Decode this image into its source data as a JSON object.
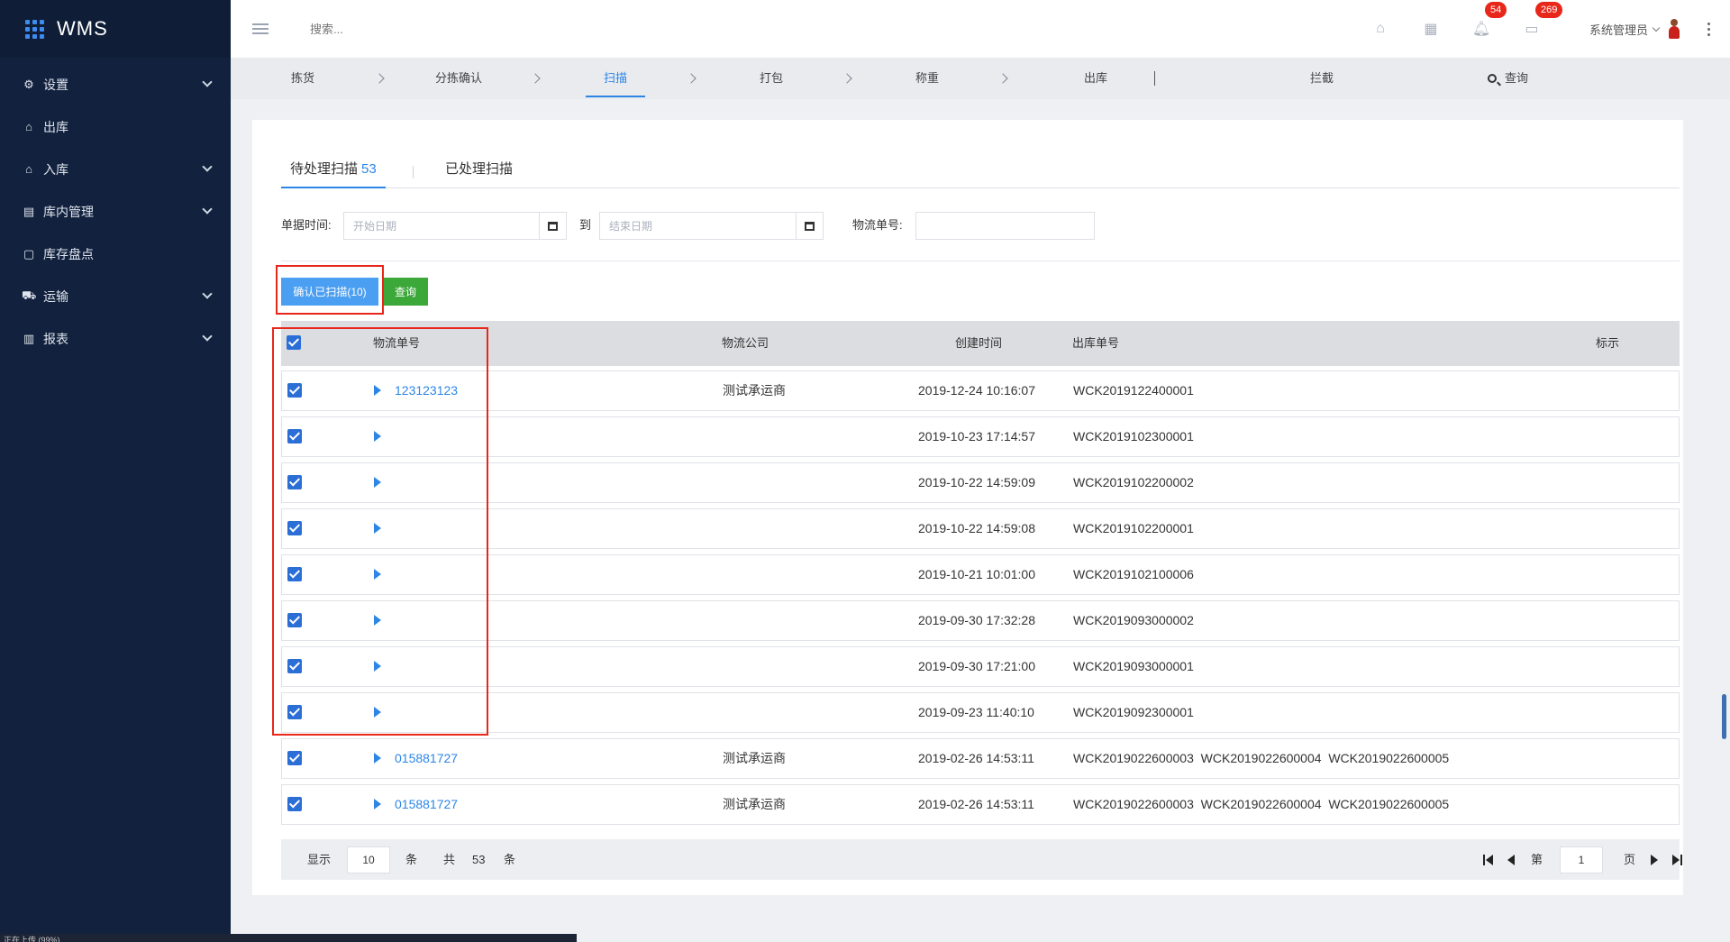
{
  "app": {
    "title": "WMS"
  },
  "sidebar": {
    "items": [
      {
        "label": "设置",
        "icon": "gear-icon",
        "glyph": "⚙",
        "has_children": true
      },
      {
        "label": "出库",
        "icon": "outbound-icon",
        "glyph": "⌂",
        "has_children": false
      },
      {
        "label": "入库",
        "icon": "inbound-icon",
        "glyph": "⌂",
        "has_children": true
      },
      {
        "label": "库内管理",
        "icon": "warehouse-icon",
        "glyph": "▤",
        "has_children": true
      },
      {
        "label": "库存盘点",
        "icon": "inventory-icon",
        "glyph": "▢",
        "has_children": false
      },
      {
        "label": "运输",
        "icon": "truck-icon",
        "glyph": "⛟",
        "has_children": true
      },
      {
        "label": "报表",
        "icon": "chart-icon",
        "glyph": "▥",
        "has_children": true
      }
    ]
  },
  "topbar": {
    "search_placeholder": "搜索...",
    "notifications_badge": "54",
    "messages_badge": "269",
    "user_name": "系统管理员"
  },
  "steps": {
    "items": [
      "拣货",
      "分拣确认",
      "扫描",
      "打包",
      "称重",
      "出库",
      "拦截"
    ],
    "active": "扫描",
    "query_label": "查询"
  },
  "tabs": {
    "pending_label": "待处理扫描",
    "pending_count": "53",
    "processed_label": "已处理扫描"
  },
  "filters": {
    "date_label": "单据时间:",
    "start_placeholder": "开始日期",
    "to_label": "到",
    "end_placeholder": "结束日期",
    "tracking_label": "物流单号:",
    "tracking_value": ""
  },
  "actions": {
    "confirm_label": "确认已扫描(10)",
    "query_label": "查询"
  },
  "table": {
    "headers": {
      "tracking_no": "物流单号",
      "carrier": "物流公司",
      "created_at": "创建时间",
      "outbound_no": "出库单号",
      "flag": "标示"
    },
    "rows": [
      {
        "tracking_no": "123123123",
        "carrier": "测试承运商",
        "created_at": "2019-12-24 10:16:07",
        "outbound_no": "WCK2019122400001",
        "checked": true
      },
      {
        "tracking_no": "",
        "carrier": "",
        "created_at": "2019-10-23 17:14:57",
        "outbound_no": "WCK2019102300001",
        "checked": true
      },
      {
        "tracking_no": "",
        "carrier": "",
        "created_at": "2019-10-22 14:59:09",
        "outbound_no": "WCK2019102200002",
        "checked": true
      },
      {
        "tracking_no": "",
        "carrier": "",
        "created_at": "2019-10-22 14:59:08",
        "outbound_no": "WCK2019102200001",
        "checked": true
      },
      {
        "tracking_no": "",
        "carrier": "",
        "created_at": "2019-10-21 10:01:00",
        "outbound_no": "WCK2019102100006",
        "checked": true
      },
      {
        "tracking_no": "",
        "carrier": "",
        "created_at": "2019-09-30 17:32:28",
        "outbound_no": "WCK2019093000002",
        "checked": true
      },
      {
        "tracking_no": "",
        "carrier": "",
        "created_at": "2019-09-30 17:21:00",
        "outbound_no": "WCK2019093000001",
        "checked": true
      },
      {
        "tracking_no": "",
        "carrier": "",
        "created_at": "2019-09-23 11:40:10",
        "outbound_no": "WCK2019092300001",
        "checked": true
      },
      {
        "tracking_no": "015881727",
        "carrier": "测试承运商",
        "created_at": "2019-02-26 14:53:11",
        "outbound_no": "WCK2019022600003  WCK2019022600004  WCK2019022600005",
        "checked": true
      },
      {
        "tracking_no": "015881727",
        "carrier": "测试承运商",
        "created_at": "2019-02-26 14:53:11",
        "outbound_no": "WCK2019022600003  WCK2019022600004  WCK2019022600005",
        "checked": true
      }
    ]
  },
  "pagination": {
    "show_label": "显示",
    "page_size": "10",
    "unit_label": "条",
    "total_label": "共",
    "total": "53",
    "total_unit": "条",
    "page_prefix": "第",
    "current_page": "1",
    "page_suffix": "页"
  },
  "colors": {
    "sidebar_bg": "#12213d",
    "accent": "#2d86e6",
    "confirm_button": "#4b9ff2",
    "query_button": "#3ba839",
    "badge": "#e8271a",
    "highlight_box": "#e8271a"
  },
  "status_strip": {
    "text": "正在上传 (99%)"
  }
}
